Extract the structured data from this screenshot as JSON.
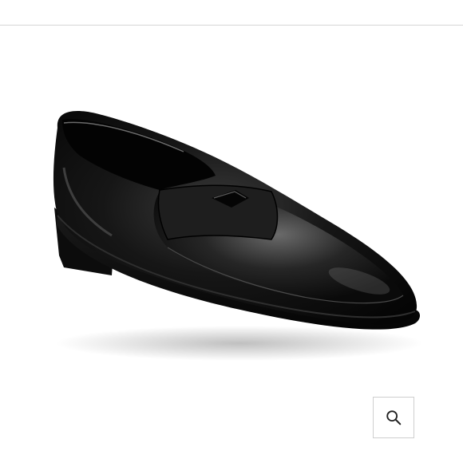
{
  "product": {
    "image_icon": "black-leather-penny-loafer-image"
  },
  "zoom_button": {
    "icon": "magnifier-icon"
  },
  "colors": {
    "divider": "#d6d6d6",
    "button_border": "#cfcfcf",
    "icon": "#222222"
  }
}
